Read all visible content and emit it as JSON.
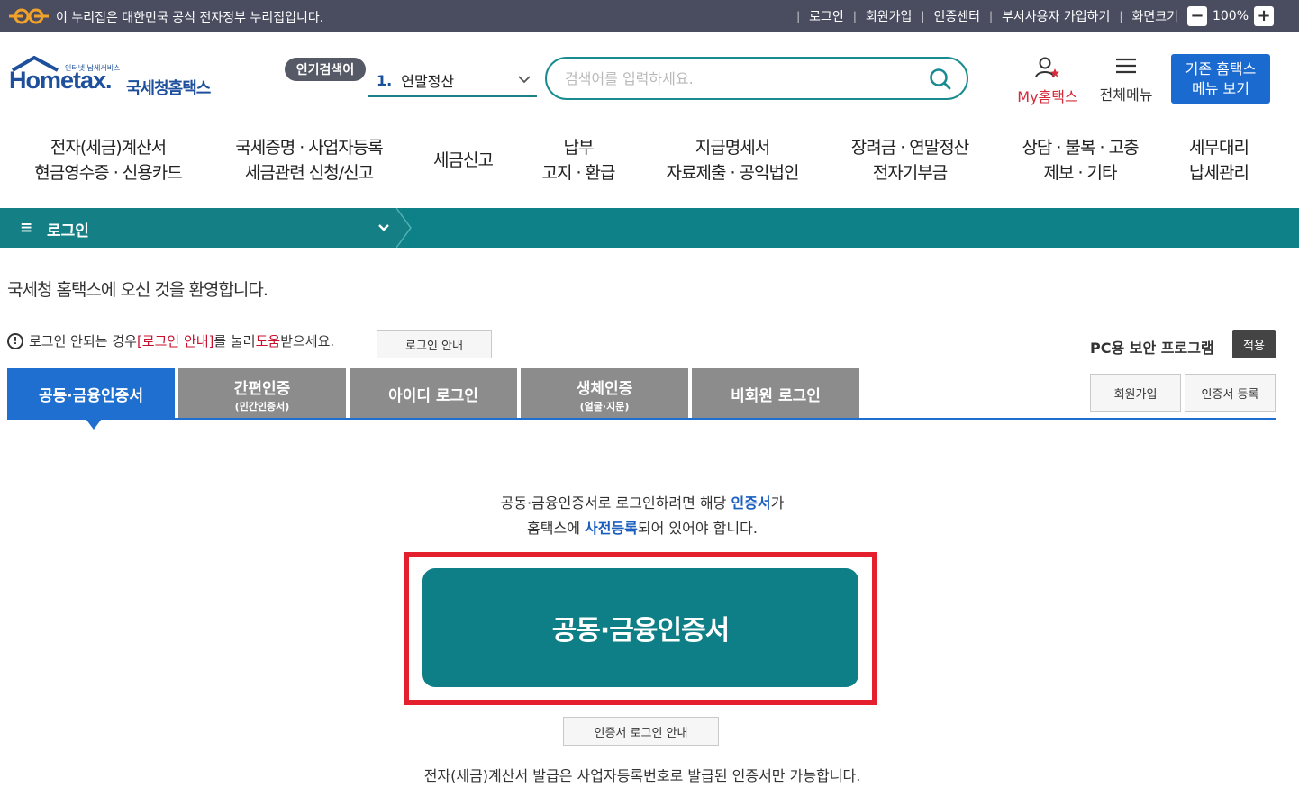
{
  "govbar": {
    "notice": "이 누리집은 대한민국 공식 전자정부 누리집입니다.",
    "links": [
      "로그인",
      "회원가입",
      "인증센터",
      "부서사용자 가입하기",
      "화면크기"
    ],
    "zoom": "100%"
  },
  "header": {
    "logo_small": "인터넷 납세서비스",
    "logo_home": "Home",
    "logo_tax": "tax.",
    "logo_kr": "국세청홈택스",
    "popular_badge": "인기검색어",
    "popular_num": "1.",
    "popular_term": "연말정산",
    "search_placeholder": "검색어를 입력하세요.",
    "my_hometax": "My홈택스",
    "all_menu": "전체메뉴",
    "old_menu_line1": "기존 홈택스",
    "old_menu_line2": "메뉴 보기"
  },
  "nav": [
    {
      "line1": "전자(세금)계산서",
      "line2": "현금영수증 · 신용카드"
    },
    {
      "line1": "국세증명 · 사업자등록",
      "line2": "세금관련 신청/신고"
    },
    {
      "line1": "세금신고",
      "line2": ""
    },
    {
      "line1": "납부",
      "line2": "고지 · 환급"
    },
    {
      "line1": "지급명세서",
      "line2": "자료제출 · 공익법인"
    },
    {
      "line1": "장려금 · 연말정산",
      "line2": "전자기부금"
    },
    {
      "line1": "상담 · 불복 · 고충",
      "line2": "제보 · 기타"
    },
    {
      "line1": "세무대리",
      "line2": "납세관리"
    }
  ],
  "breadcrumb": {
    "label": "로그인"
  },
  "welcome": "국세청 홈택스에 오신 것을 환영합니다.",
  "help": {
    "pre": "로그인 안되는 경우 ",
    "link1": "[로그인 안내]",
    "mid": "를 눌러 ",
    "link2": "도움",
    "post": "받으세요.",
    "button": "로그인 안내"
  },
  "pc_security": {
    "label": "PC용 보안 프로그램",
    "apply": "적용"
  },
  "tabs": [
    {
      "label": "공동·금융인증서",
      "sub": ""
    },
    {
      "label": "간편인증",
      "sub": "(민간인증서)"
    },
    {
      "label": "아이디 로그인",
      "sub": ""
    },
    {
      "label": "생체인증",
      "sub": "(얼굴·지문)"
    },
    {
      "label": "비회원 로그인",
      "sub": ""
    }
  ],
  "right_buttons": {
    "join": "회원가입",
    "cert_register": "인증서 등록"
  },
  "desc": {
    "l1_pre": "공동·금융인증서로 로그인하려면 해당 ",
    "l1_em": "인증서",
    "l1_post": "가",
    "l2_pre": "홈택스에 ",
    "l2_em": "사전등록",
    "l2_post": "되어 있어야 합니다."
  },
  "cert_button": "공동·금융인증서",
  "cert_guide_button": "인증서 로그인 안내",
  "footer_note": "전자(세금)계산서 발급은 사업자등록번호로 발급된 인증서만 가능합니다."
}
